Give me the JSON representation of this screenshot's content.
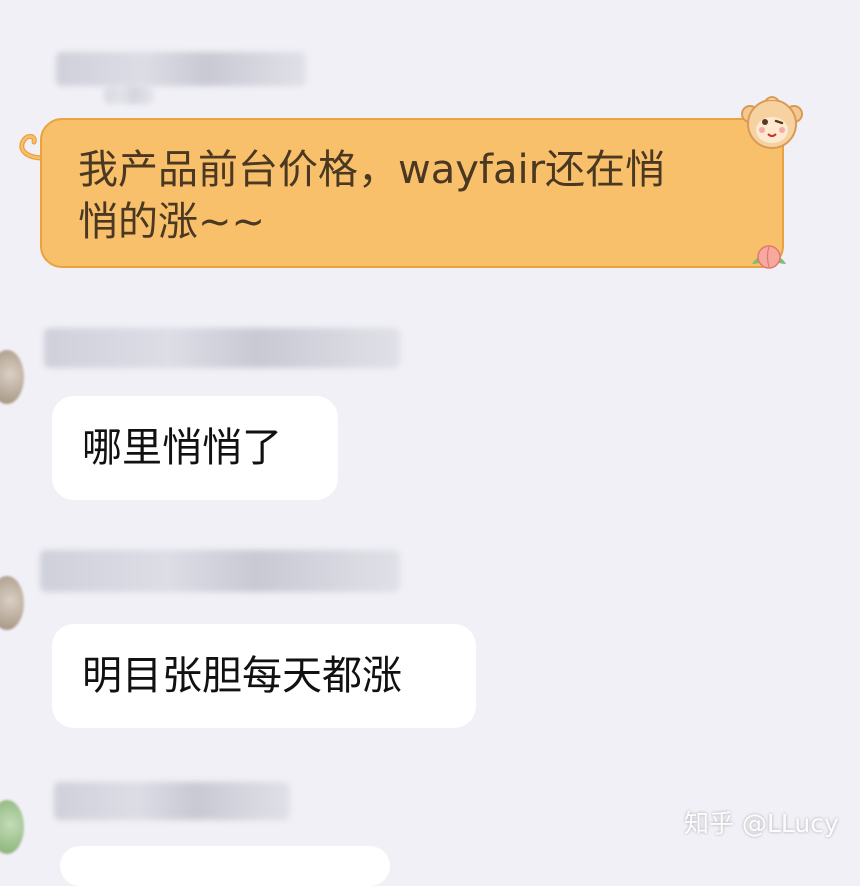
{
  "messages": [
    {
      "text": "我产品前台价格，wayfair还在悄\n悄的涨~~",
      "style": "orange-bubble",
      "sender_obscured": true
    },
    {
      "text": "哪里悄悄了",
      "style": "white-bubble",
      "sender_obscured": true
    },
    {
      "text": "明目张胆每天都涨",
      "style": "white-bubble",
      "sender_obscured": true
    }
  ],
  "watermark": "知乎 @LLucy",
  "colors": {
    "background": "#f1f0f6",
    "orange_bubble": "#f8c06b",
    "orange_border": "#e8a23e",
    "white_bubble": "#ffffff",
    "text": "#111111"
  },
  "icons": [
    "monkey-sticker-icon",
    "peach-icon",
    "monkey-tail-icon"
  ]
}
